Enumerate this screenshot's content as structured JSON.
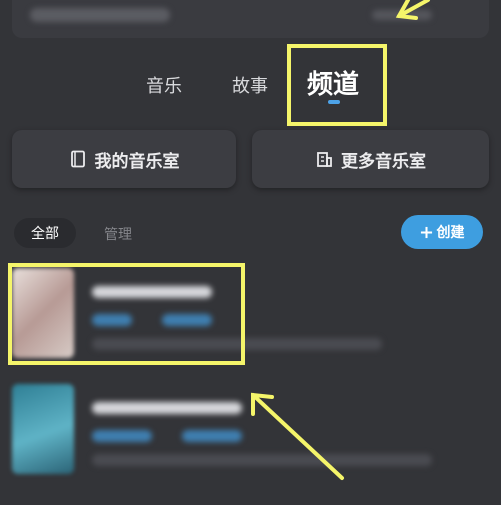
{
  "tabs": {
    "music": "音乐",
    "story": "故事",
    "channel": "频道"
  },
  "rooms": {
    "mine": "我的音乐室",
    "more": "更多音乐室"
  },
  "filters": {
    "all": "全部",
    "manage": "管理"
  },
  "create": {
    "label": "创建",
    "icon": "plus-icon"
  },
  "colors": {
    "highlight": "#f5f56a",
    "accent": "#3e9ee0",
    "background": "#333438"
  }
}
